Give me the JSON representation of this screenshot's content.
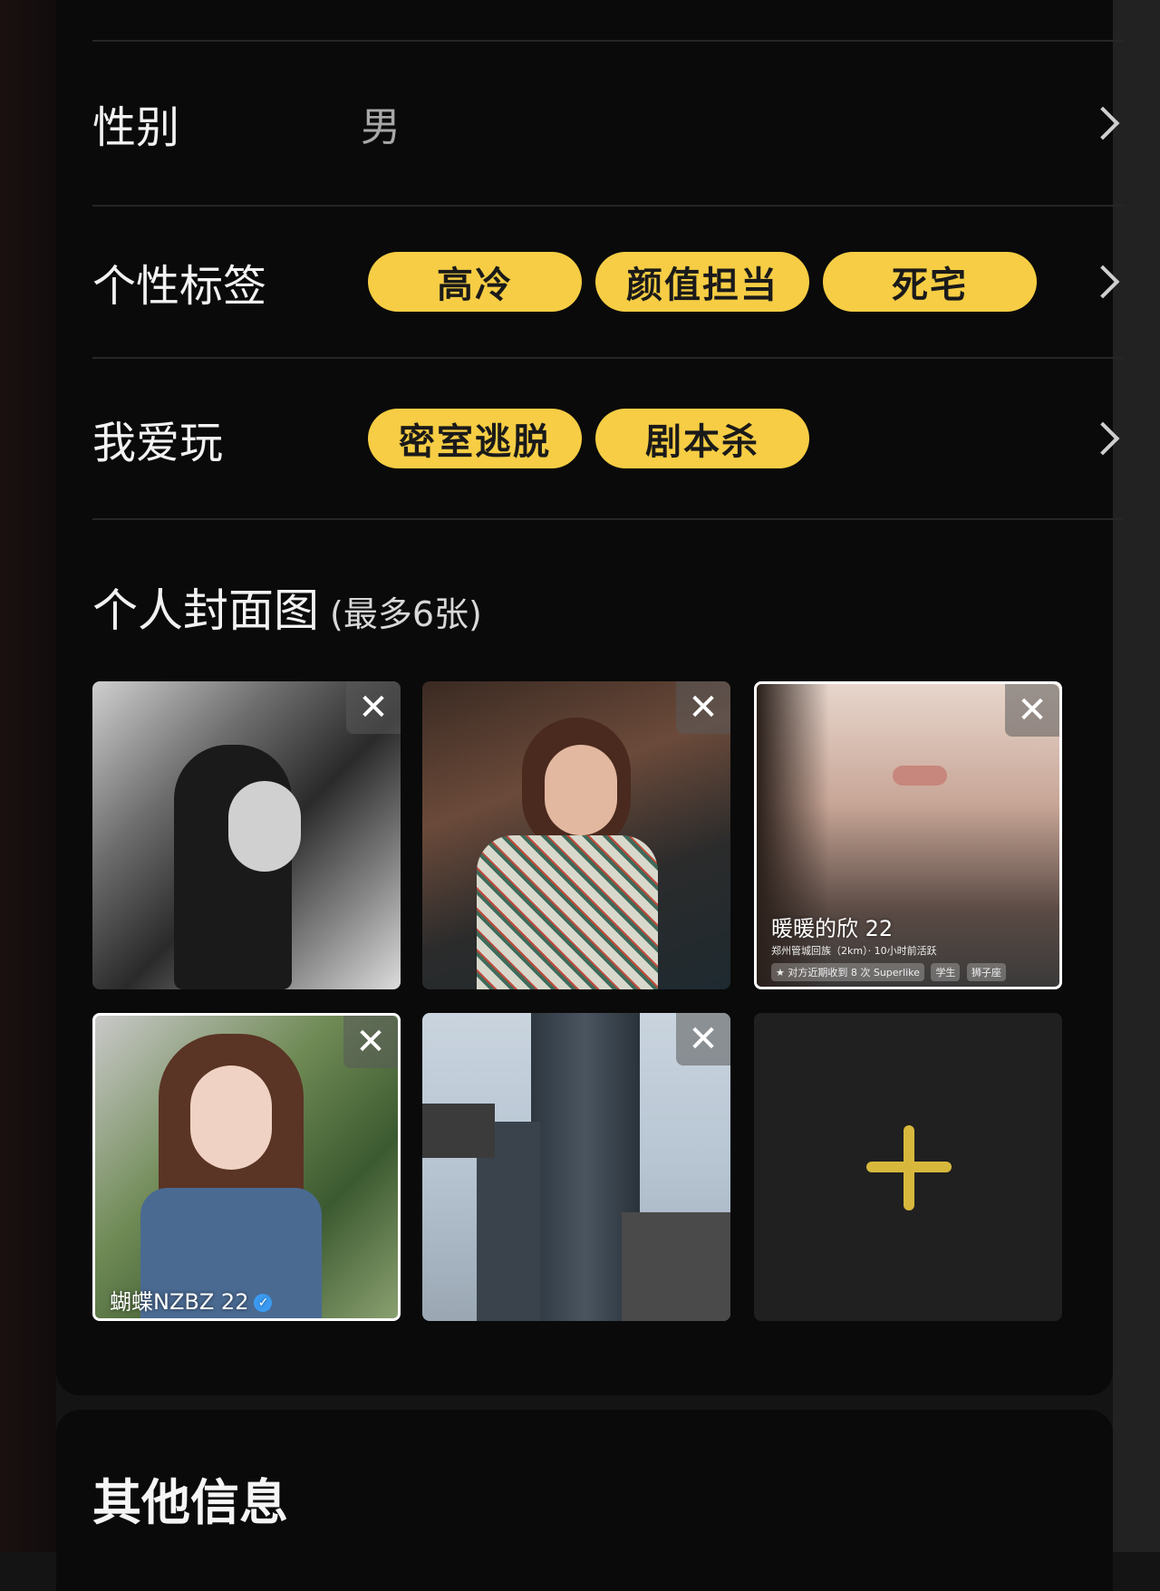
{
  "gender_row": {
    "label": "性别",
    "value": "男"
  },
  "tags_row": {
    "label": "个性标签",
    "tags": [
      "高冷",
      "颜值担当",
      "死宅"
    ]
  },
  "play_row": {
    "label": "我爱玩",
    "tags": [
      "密室逃脱",
      "剧本杀"
    ]
  },
  "cover": {
    "title": "个人封面图",
    "limit_note": "(最多6张)",
    "remove_symbol": "✕",
    "photos": [
      {
        "name": "",
        "overlay": null
      },
      {
        "name": "",
        "overlay": null
      },
      {
        "name": "暖暖的欣 22",
        "line2": "郑州管城回族（2km）· 10小时前活跃",
        "badges": [
          "★ 对方近期收到 8 次 Superlike",
          "学生",
          "狮子座"
        ]
      },
      {
        "name": "蝴蝶NZBZ 22",
        "verified": true
      },
      {
        "name": "",
        "overlay": null
      }
    ],
    "add_icon": "plus-icon"
  },
  "other_info": {
    "title": "其他信息"
  },
  "colors": {
    "accent": "#f6cd44",
    "background": "#0a0a0a",
    "text": "#f2f2f2"
  }
}
